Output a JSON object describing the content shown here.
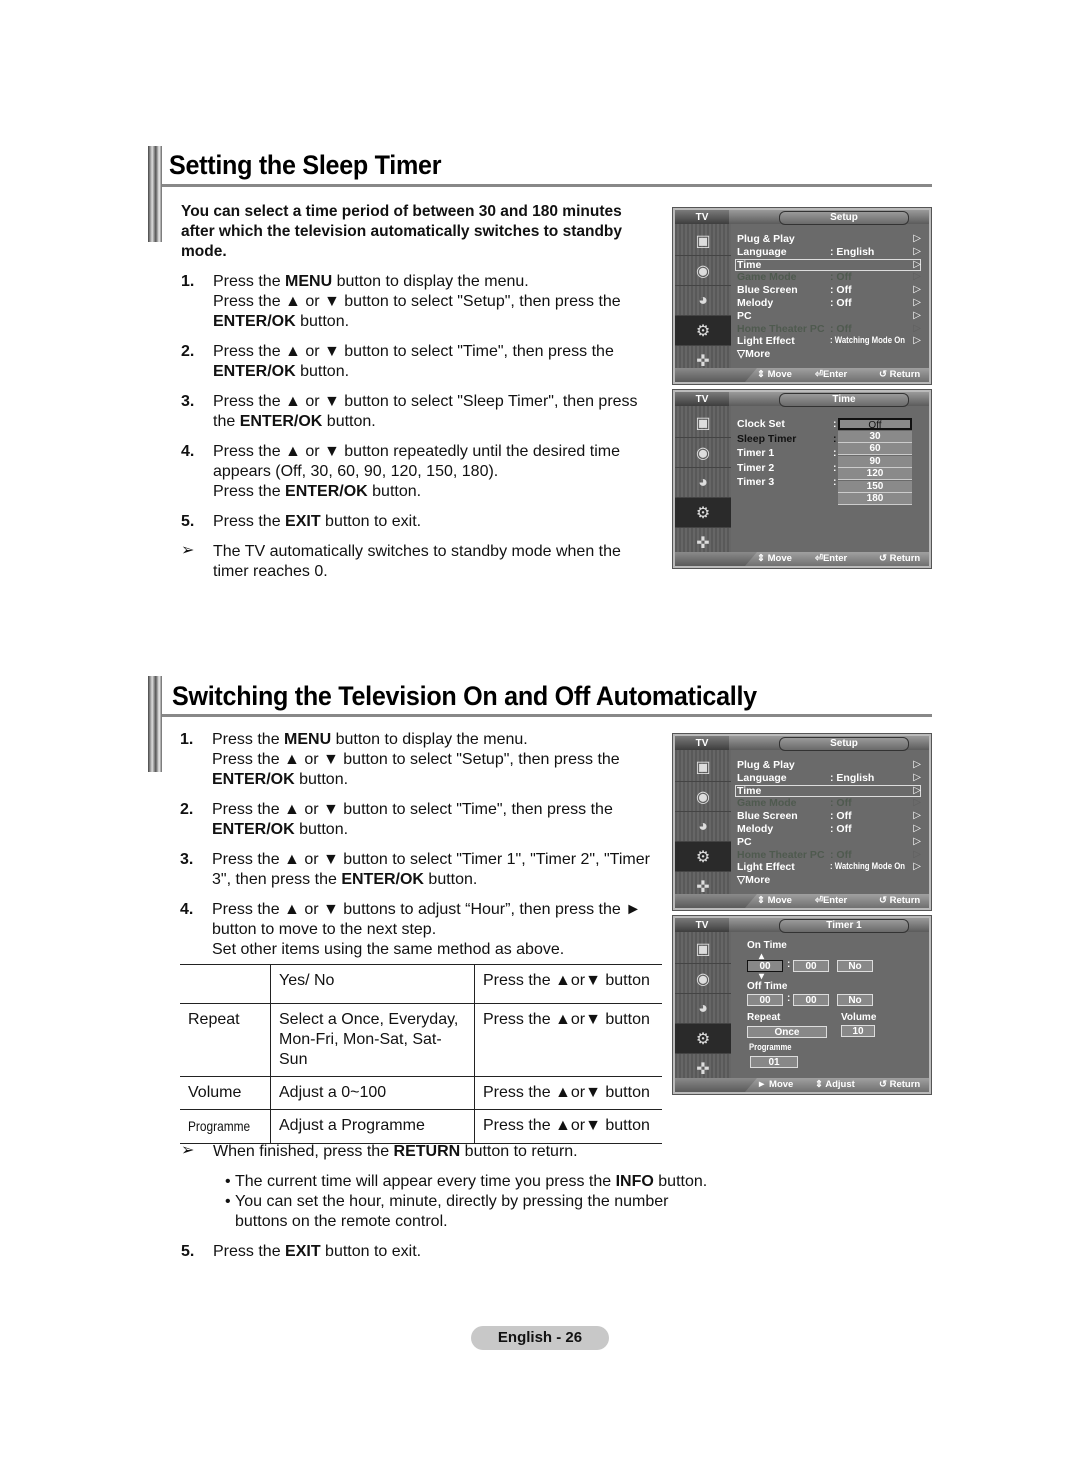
{
  "sections": {
    "sleep": {
      "title": "Setting the Sleep Timer",
      "intro": "You can select a time period of between 30 and 180 minutes after which the television automatically switches to standby mode.",
      "steps": [
        {
          "num": "1.",
          "parts": [
            [
              "Press the ",
              ""
            ],
            [
              "MENU",
              "b"
            ],
            [
              " button to display the menu.",
              ""
            ],
            [
              "\n",
              "br"
            ],
            [
              "Press the ▲ or ▼ button to select \"Setup\", then press the ",
              ""
            ],
            [
              "ENTER/OK",
              "b"
            ],
            [
              " button.",
              ""
            ]
          ]
        },
        {
          "num": "2.",
          "parts": [
            [
              "Press the ▲ or ▼ button to select \"Time\", then press the ",
              ""
            ],
            [
              "ENTER/OK",
              "b"
            ],
            [
              " button.",
              ""
            ]
          ]
        },
        {
          "num": "3.",
          "parts": [
            [
              "Press the ▲ or ▼ button to select \"Sleep Timer\", then press the ",
              ""
            ],
            [
              "ENTER/OK",
              "b"
            ],
            [
              " button.",
              ""
            ]
          ]
        },
        {
          "num": "4.",
          "parts": [
            [
              "Press the ▲ or ▼ button repeatedly until the desired time appears (Off, 30, 60, 90, 120, 150, 180).",
              ""
            ],
            [
              "\n",
              "br"
            ],
            [
              "Press the ",
              ""
            ],
            [
              "ENTER/OK",
              "b"
            ],
            [
              " button.",
              ""
            ]
          ]
        },
        {
          "num": "5.",
          "parts": [
            [
              "Press the ",
              ""
            ],
            [
              "EXIT",
              "b"
            ],
            [
              " button to exit.",
              ""
            ]
          ]
        }
      ],
      "note": "The TV automatically switches to standby mode when the timer reaches 0."
    },
    "auto": {
      "title": "Switching the Television On and Off Automatically",
      "steps": [
        {
          "num": "1.",
          "parts": [
            [
              "Press the ",
              ""
            ],
            [
              "MENU",
              "b"
            ],
            [
              " button to display the menu.",
              ""
            ],
            [
              "\n",
              "br"
            ],
            [
              "Press the ▲ or ▼ button to select \"Setup\", then press the ",
              ""
            ],
            [
              "ENTER/OK",
              "b"
            ],
            [
              " button.",
              ""
            ]
          ]
        },
        {
          "num": "2.",
          "parts": [
            [
              "Press the ▲ or ▼ button to select \"Time\", then press the ",
              ""
            ],
            [
              "ENTER/OK",
              "b"
            ],
            [
              " button.",
              ""
            ]
          ]
        },
        {
          "num": "3.",
          "parts": [
            [
              "Press the ▲ or ▼ button to select \"Timer 1\", \"Timer 2\", \"Timer 3\", then press the ",
              ""
            ],
            [
              "ENTER/OK",
              "b"
            ],
            [
              " button.",
              ""
            ]
          ]
        },
        {
          "num": "4.",
          "parts": [
            [
              "Press the ▲ or ▼ buttons to adjust “Hour”, then press the ► button to move to the next step.",
              ""
            ],
            [
              "\n",
              "br"
            ],
            [
              "Set other items using the same method as above.",
              ""
            ]
          ]
        }
      ],
      "table": [
        [
          "",
          "Yes/ No",
          "Press the ▲or▼ button"
        ],
        [
          "Repeat",
          "Select a Once, Everyday, Mon-Fri, Mon-Sat, Sat-Sun",
          "Press the ▲or▼ button"
        ],
        [
          "Volume",
          "Adjust a 0~100",
          "Press the ▲or▼ button"
        ],
        [
          "Programme",
          "Adjust a Programme",
          "Press the ▲or▼ button"
        ]
      ],
      "note": [
        [
          "When finished, press the ",
          ""
        ],
        [
          "RETURN",
          "b"
        ],
        [
          " button to return.",
          ""
        ]
      ],
      "bullets": [
        [
          [
            "The current time will appear every time you press the ",
            ""
          ],
          [
            "INFO",
            "b"
          ],
          [
            " button.",
            ""
          ]
        ],
        [
          [
            "You can set the hour, minute, directly by pressing the number buttons on the remote control.",
            ""
          ]
        ]
      ],
      "step5": {
        "num": "5.",
        "parts": [
          [
            "Press the ",
            ""
          ],
          [
            "EXIT",
            "b"
          ],
          [
            " button to exit.",
            ""
          ]
        ]
      }
    }
  },
  "osd": {
    "tv_label": "TV",
    "setup": {
      "title": "Setup",
      "items": [
        {
          "label": "Plug & Play",
          "value": "",
          "dim": false
        },
        {
          "label": "Language",
          "value": ": English",
          "dim": false
        },
        {
          "label": "Time",
          "value": "",
          "dim": false,
          "selected": true
        },
        {
          "label": "Game Mode",
          "value": ": Off",
          "dim": true
        },
        {
          "label": "Blue Screen",
          "value": ": Off",
          "dim": false
        },
        {
          "label": "Melody",
          "value": ": Off",
          "dim": false
        },
        {
          "label": "PC",
          "value": "",
          "dim": false
        },
        {
          "label": "Home Theater PC",
          "value": ": Off",
          "dim": true
        },
        {
          "label": "Light Effect",
          "value": ": Watching Mode On",
          "dim": false
        }
      ],
      "more": "▽More",
      "hints": [
        "⇕ Move",
        "⏎Enter",
        "↺ Return"
      ]
    },
    "time": {
      "title": "Time",
      "items": [
        "Clock Set",
        "Sleep Timer",
        "Timer 1",
        "Timer 2",
        "Timer 3"
      ],
      "options": [
        "Off",
        "30",
        "60",
        "90",
        "120",
        "150",
        "180"
      ],
      "current_option": "Off",
      "hints": [
        "⇕ Move",
        "⏎Enter",
        "↺ Return"
      ]
    },
    "timer1": {
      "title": "Timer 1",
      "on_time_label": "On Time",
      "on_hour": "00",
      "on_minute": "00",
      "on_flag": "No",
      "off_time_label": "Off Time",
      "off_hour": "00",
      "off_minute": "00",
      "off_flag": "No",
      "repeat_label": "Repeat",
      "repeat_value": "Once",
      "volume_label": "Volume",
      "volume_value": "10",
      "programme_label": "Programme",
      "programme_value": "01",
      "hints": [
        "► Move",
        "⇕ Adjust",
        "↺ Return"
      ]
    }
  },
  "footer": {
    "page_label": "English - 26"
  },
  "icons": [
    "picture-icon",
    "sound-icon",
    "channel-icon",
    "setup-icon",
    "input-icon"
  ]
}
